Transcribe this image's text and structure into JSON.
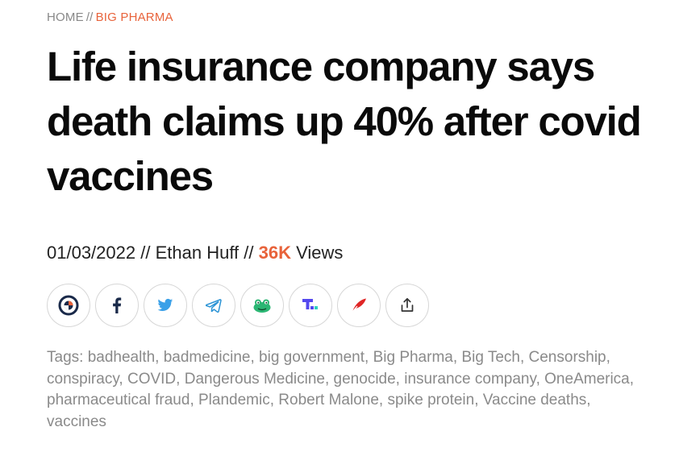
{
  "breadcrumb": {
    "home_label": "HOME",
    "separator": "//",
    "current_label": "BIG PHARMA"
  },
  "article": {
    "title": "Life insurance company says death claims up 40% after covid vaccines",
    "date": "01/03/2022",
    "separator": "//",
    "author": "Ethan Huff",
    "views_count": "36K",
    "views_label": "Views"
  },
  "share": {
    "buttons": [
      {
        "icon": "brighteon-icon",
        "color": "#1a2a4a"
      },
      {
        "icon": "facebook-icon",
        "color": "#1a2a4a"
      },
      {
        "icon": "twitter-icon",
        "color": "#3aa0e8"
      },
      {
        "icon": "telegram-icon",
        "color": "#2a93d5"
      },
      {
        "icon": "gab-frog-icon",
        "color": "#2bb673"
      },
      {
        "icon": "truth-social-icon",
        "color": "#5448ee"
      },
      {
        "icon": "gettr-icon",
        "color": "#e02626"
      },
      {
        "icon": "share-upload-icon",
        "color": "#333333"
      }
    ]
  },
  "tags": {
    "prefix": "Tags: ",
    "items": [
      "badhealth",
      "badmedicine",
      "big government",
      "Big Pharma",
      "Big Tech",
      "Censorship",
      "conspiracy",
      "COVID",
      "Dangerous Medicine",
      "genocide",
      "insurance company",
      "OneAmerica",
      "pharmaceutical fraud",
      "Plandemic",
      "Robert Malone",
      "spike protein",
      "Vaccine deaths",
      "vaccines"
    ]
  },
  "colors": {
    "accent": "#e8633b",
    "tag_text": "#8a8a8a",
    "title": "#0a0a0a"
  }
}
